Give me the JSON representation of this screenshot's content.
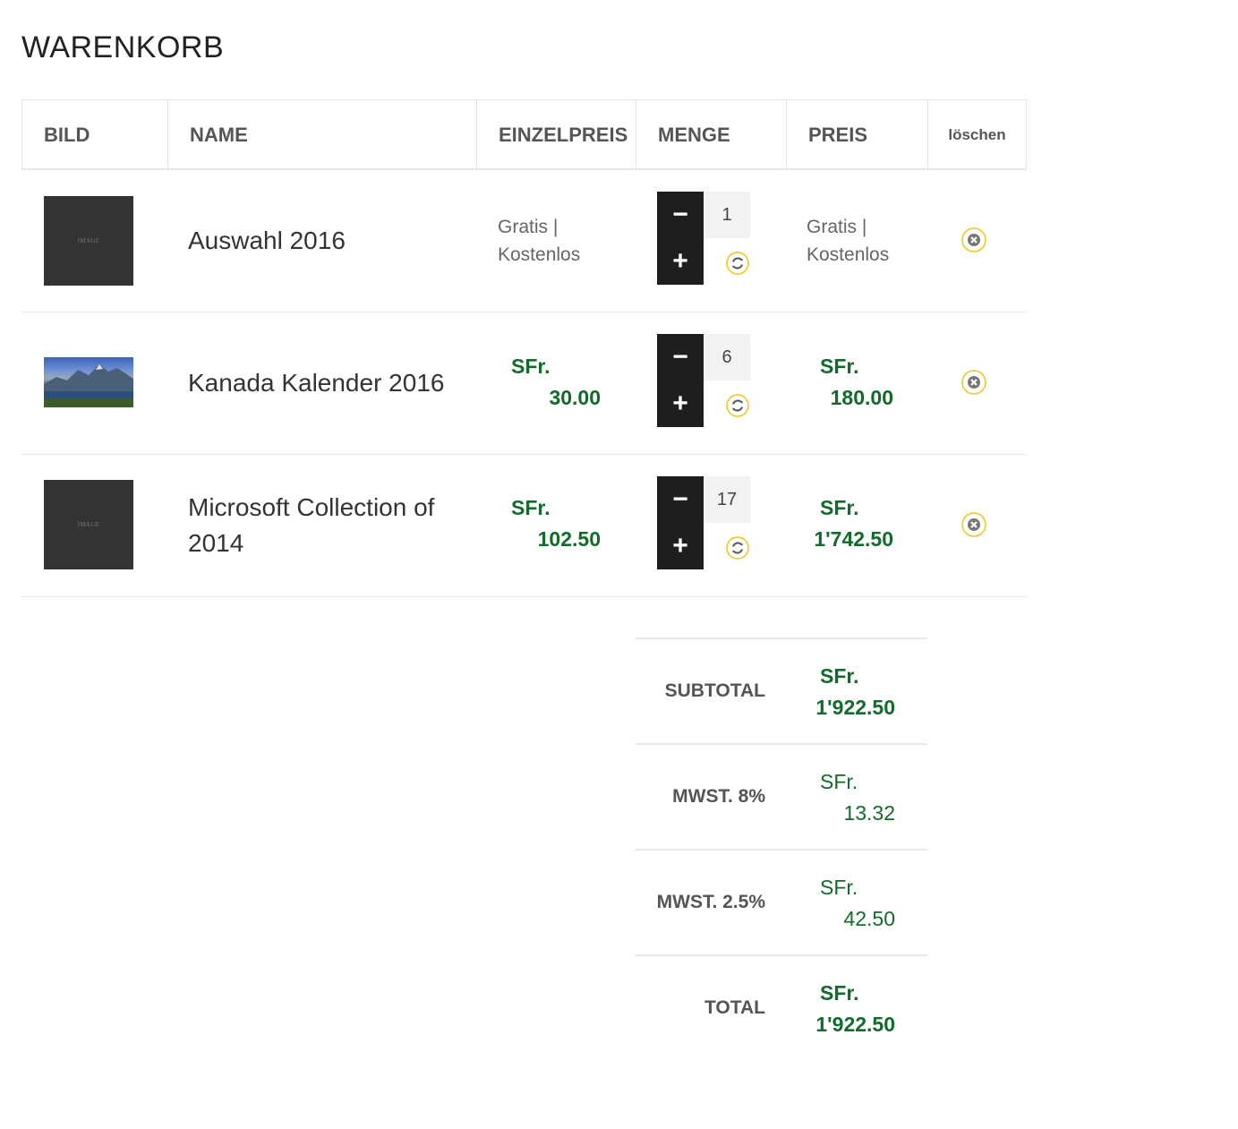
{
  "page_title": "WARENKORB",
  "columns": {
    "image": "BILD",
    "name": "NAME",
    "unit_price": "EINZELPREIS",
    "quantity": "MENGE",
    "price": "PREIS",
    "delete": "löschen"
  },
  "items": [
    {
      "image_label": "IMAGE",
      "name": "Auswahl 2016",
      "unit_price": {
        "currency": "Gratis |",
        "amount": "Kostenlos"
      },
      "quantity": "1",
      "price": {
        "currency": "Gratis |",
        "amount": "Kostenlos"
      }
    },
    {
      "image_label": "",
      "name": "Kanada Kalender 2016",
      "unit_price": {
        "currency": "SFr.",
        "amount": "30.00"
      },
      "quantity": "6",
      "price": {
        "currency": "SFr.",
        "amount": "180.00"
      }
    },
    {
      "image_label": "IMAGE",
      "name": "Microsoft Collection of 2014",
      "unit_price": {
        "currency": "SFr.",
        "amount": "102.50"
      },
      "quantity": "17",
      "price": {
        "currency": "SFr.",
        "amount": "1'742.50"
      }
    }
  ],
  "totals": {
    "subtotal": {
      "label": "SUBTOTAL",
      "currency": "SFr.",
      "amount": "1'922.50"
    },
    "vat_8": {
      "label": "MWST. 8%",
      "currency": "SFr.",
      "amount": "13.32"
    },
    "vat_25": {
      "label": "MWST. 2.5%",
      "currency": "SFr.",
      "amount": "42.50"
    },
    "total": {
      "label": "TOTAL",
      "currency": "SFr.",
      "amount": "1'922.50"
    }
  },
  "controls": {
    "minus": "−",
    "plus": "+"
  },
  "icons": {
    "refresh": "refresh-icon",
    "remove": "remove-icon"
  },
  "colors": {
    "price_green": "#126a2b",
    "accent_yellow": "#f0c419",
    "qty_dark": "#1e1e1e"
  }
}
